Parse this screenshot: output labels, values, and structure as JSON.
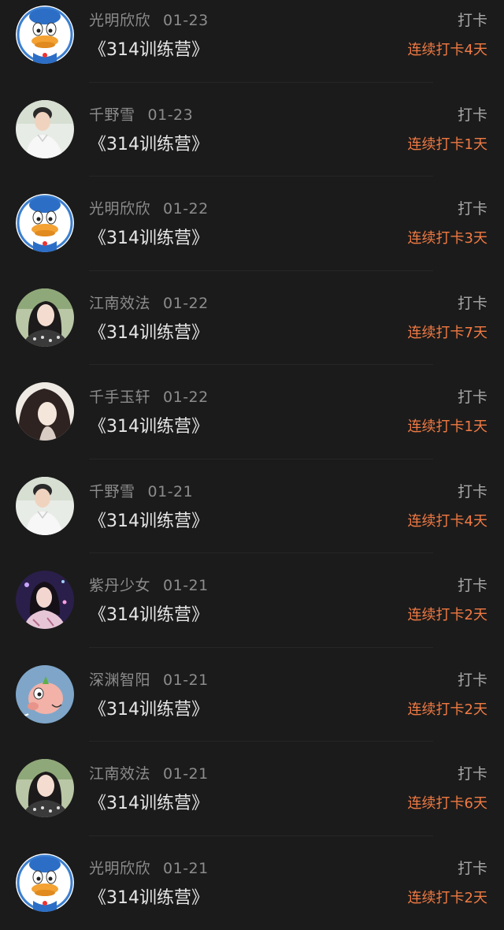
{
  "checkins": [
    {
      "user": "光明欣欣",
      "date": "01-23",
      "title": "《314训练营》",
      "action": "打卡",
      "streak": "连续打卡4天",
      "avatar": "donald-duck-icon"
    },
    {
      "user": "千野雪",
      "date": "01-23",
      "title": "《314训练营》",
      "action": "打卡",
      "streak": "连续打卡1天",
      "avatar": "boy-photo-icon"
    },
    {
      "user": "光明欣欣",
      "date": "01-22",
      "title": "《314训练营》",
      "action": "打卡",
      "streak": "连续打卡3天",
      "avatar": "donald-duck-icon"
    },
    {
      "user": "江南效法",
      "date": "01-22",
      "title": "《314训练营》",
      "action": "打卡",
      "streak": "连续打卡7天",
      "avatar": "girl-photo-icon"
    },
    {
      "user": "千手玉轩",
      "date": "01-22",
      "title": "《314训练营》",
      "action": "打卡",
      "streak": "连续打卡1天",
      "avatar": "anime-girl-icon"
    },
    {
      "user": "千野雪",
      "date": "01-21",
      "title": "《314训练营》",
      "action": "打卡",
      "streak": "连续打卡4天",
      "avatar": "boy-photo-icon"
    },
    {
      "user": "紫丹少女",
      "date": "01-21",
      "title": "《314训练营》",
      "action": "打卡",
      "streak": "连续打卡2天",
      "avatar": "purple-girl-icon"
    },
    {
      "user": "深渊智阳",
      "date": "01-21",
      "title": "《314训练营》",
      "action": "打卡",
      "streak": "连续打卡2天",
      "avatar": "cartoon-pig-icon"
    },
    {
      "user": "江南效法",
      "date": "01-21",
      "title": "《314训练营》",
      "action": "打卡",
      "streak": "连续打卡6天",
      "avatar": "girl-photo-icon"
    },
    {
      "user": "光明欣欣",
      "date": "01-21",
      "title": "《314训练营》",
      "action": "打卡",
      "streak": "连续打卡2天",
      "avatar": "donald-duck-icon"
    }
  ],
  "colors": {
    "background": "#1b1b1b",
    "streak": "#f07a43",
    "title": "#e6e6e6",
    "meta": "#8c8c8c"
  }
}
